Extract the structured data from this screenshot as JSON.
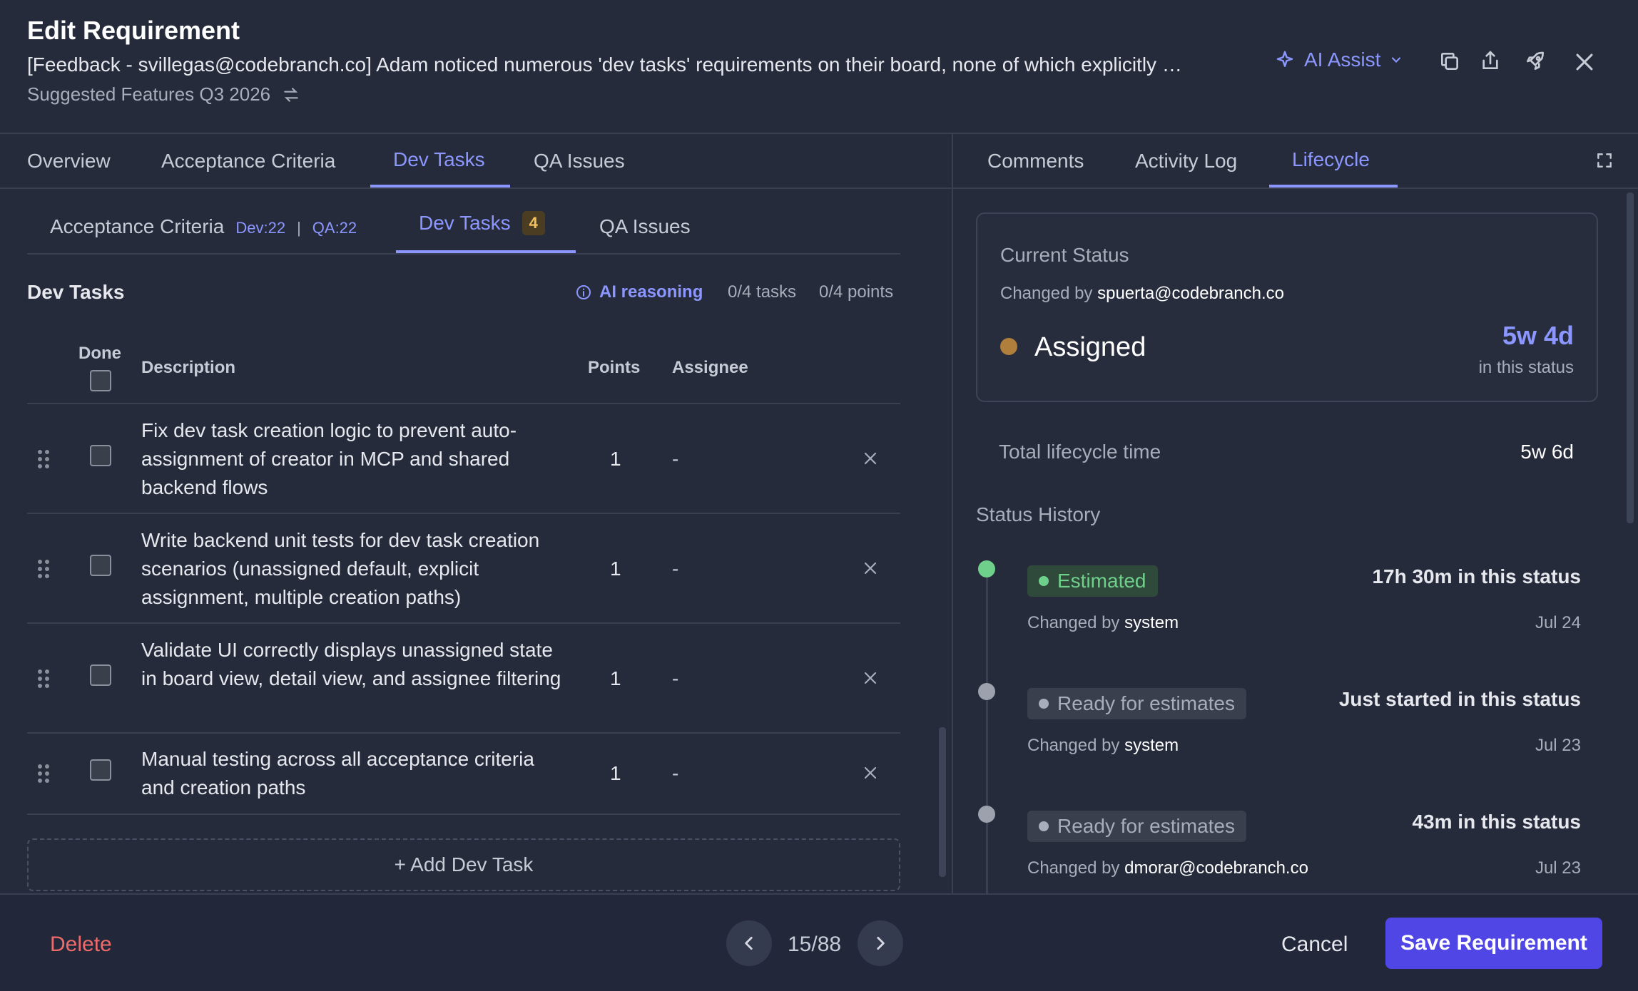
{
  "header": {
    "title": "Edit Requirement",
    "subtitle": "[Feedback - svillegas@codebranch.co] Adam noticed numerous 'dev tasks' requirements on their board, none of which explicitly …",
    "board": "Suggested Features Q3 2026",
    "ai_assist": "AI Assist"
  },
  "left_tabs": [
    {
      "label": "Overview"
    },
    {
      "label": "Acceptance Criteria"
    },
    {
      "label": "Dev Tasks"
    },
    {
      "label": "QA Issues"
    }
  ],
  "right_tabs": [
    {
      "label": "Comments"
    },
    {
      "label": "Activity Log"
    },
    {
      "label": "Lifecycle"
    }
  ],
  "sub_tabs": {
    "acceptance": {
      "label": "Acceptance Criteria",
      "dev": "Dev:22",
      "sep": "|",
      "qa": "QA:22"
    },
    "dev": {
      "label": "Dev Tasks",
      "count": "4"
    },
    "qa": {
      "label": "QA Issues"
    }
  },
  "dev_tasks": {
    "section_title": "Dev Tasks",
    "ai_reasoning": "AI reasoning",
    "tasks_count": "0/4 tasks",
    "points_count": "0/4 points",
    "headers": {
      "done": "Done",
      "description": "Description",
      "points": "Points",
      "assignee": "Assignee"
    },
    "rows": [
      {
        "description": "Fix dev task creation logic to prevent auto-assignment of creator in MCP and shared backend flows",
        "points": "1",
        "assignee": "-"
      },
      {
        "description": "Write backend unit tests for dev task creation scenarios (unassigned default, explicit assignment, multiple creation paths)",
        "points": "1",
        "assignee": "-"
      },
      {
        "description": "Validate UI correctly displays unassigned state in board view, detail view, and assignee filtering",
        "points": "1",
        "assignee": "-"
      },
      {
        "description": "Manual testing across all acceptance criteria and creation paths",
        "points": "1",
        "assignee": "-"
      }
    ],
    "add_label": "+ Add Dev Task"
  },
  "lifecycle": {
    "current_status_label": "Current Status",
    "changed_by_prefix": "Changed by",
    "changed_by": "spuerta@codebranch.co",
    "status": "Assigned",
    "duration": "5w 4d",
    "duration_caption": "in this status",
    "total_label": "Total lifecycle time",
    "total_value": "5w 6d",
    "history_title": "Status History",
    "history": [
      {
        "status": "Estimated",
        "duration": "17h 30m in this status",
        "changed_by": "system",
        "date": "Jul 24"
      },
      {
        "status": "Ready for estimates",
        "duration": "Just started in this status",
        "changed_by": "system",
        "date": "Jul 23"
      },
      {
        "status": "Ready for estimates",
        "duration": "43m in this status",
        "changed_by": "dmorar@codebranch.co",
        "date": "Jul 23"
      }
    ]
  },
  "footer": {
    "delete": "Delete",
    "pager": "15/88",
    "cancel": "Cancel",
    "save": "Save Requirement"
  },
  "colors": {
    "accent": "#8b97ff",
    "primary_button": "#4f46e5",
    "danger": "#ef6b6b",
    "assigned_dot": "#b07f3c",
    "estimated": "#6fd08c"
  }
}
